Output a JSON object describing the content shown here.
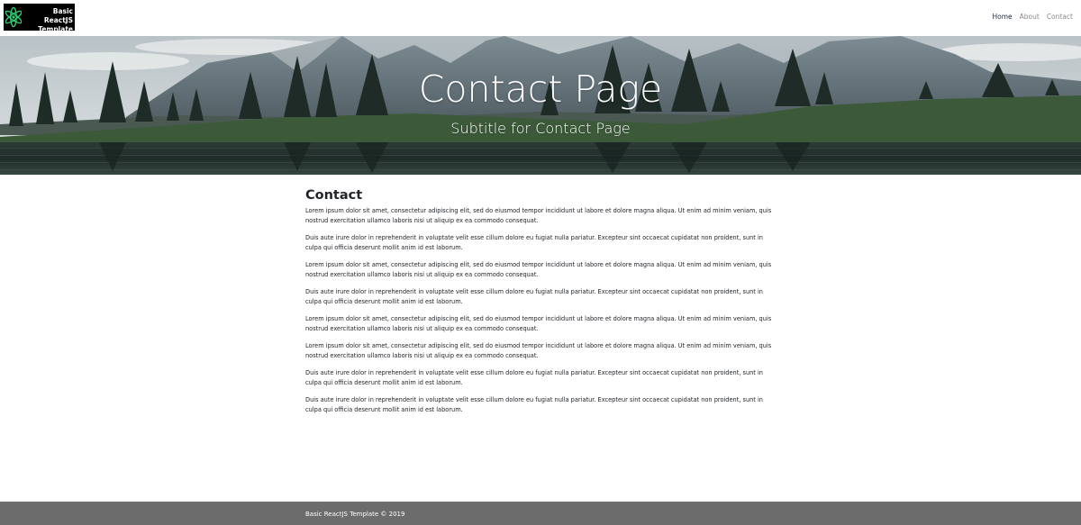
{
  "navbar": {
    "brand_text": "Basic ReactJS\nTemplate",
    "links": [
      {
        "label": "Home",
        "active": true
      },
      {
        "label": "About",
        "active": false
      },
      {
        "label": "Contact",
        "active": false
      }
    ]
  },
  "hero": {
    "title": "Contact Page",
    "subtitle": "Subtitle for Contact Page"
  },
  "content": {
    "heading": "Contact",
    "paragraphs": [
      "Lorem ipsum dolor sit amet, consectetur adipiscing elit, sed do eiusmod tempor incididunt ut labore et dolore magna aliqua. Ut enim ad minim veniam, quis nostrud exercitation ullamco laboris nisi ut aliquip ex ea commodo consequat.",
      "Duis aute irure dolor in reprehenderit in voluptate velit esse cillum dolore eu fugiat nulla pariatur. Excepteur sint occaecat cupidatat non proident, sunt in culpa qui officia deserunt mollit anim id est laborum.",
      "Lorem ipsum dolor sit amet, consectetur adipiscing elit, sed do eiusmod tempor incididunt ut labore et dolore magna aliqua. Ut enim ad minim veniam, quis nostrud exercitation ullamco laboris nisi ut aliquip ex ea commodo consequat.",
      "Duis aute irure dolor in reprehenderit in voluptate velit esse cillum dolore eu fugiat nulla pariatur. Excepteur sint occaecat cupidatat non proident, sunt in culpa qui officia deserunt mollit anim id est laborum.",
      "Lorem ipsum dolor sit amet, consectetur adipiscing elit, sed do eiusmod tempor incididunt ut labore et dolore magna aliqua. Ut enim ad minim veniam, quis nostrud exercitation ullamco laboris nisi ut aliquip ex ea commodo consequat.",
      "Lorem ipsum dolor sit amet, consectetur adipiscing elit, sed do eiusmod tempor incididunt ut labore et dolore magna aliqua. Ut enim ad minim veniam, quis nostrud exercitation ullamco laboris nisi ut aliquip ex ea commodo consequat.",
      "Duis aute irure dolor in reprehenderit in voluptate velit esse cillum dolore eu fugiat nulla pariatur. Excepteur sint occaecat cupidatat non proident, sunt in culpa qui officia deserunt mollit anim id est laborum.",
      "Duis aute irure dolor in reprehenderit in voluptate velit esse cillum dolore eu fugiat nulla pariatur. Excepteur sint occaecat cupidatat non proident, sunt in culpa qui officia deserunt mollit anim id est laborum."
    ]
  },
  "footer": {
    "text": "Basic ReactJS Template © 2019"
  },
  "colors": {
    "footer_bg": "#6c6c6c",
    "brand_bg": "#000000",
    "logo_accent": "#2ecc71",
    "active_link": "#1d2b3a",
    "inactive_link": "#8a8a8a"
  },
  "icons": {
    "brand_logo": "react-atom-icon"
  }
}
